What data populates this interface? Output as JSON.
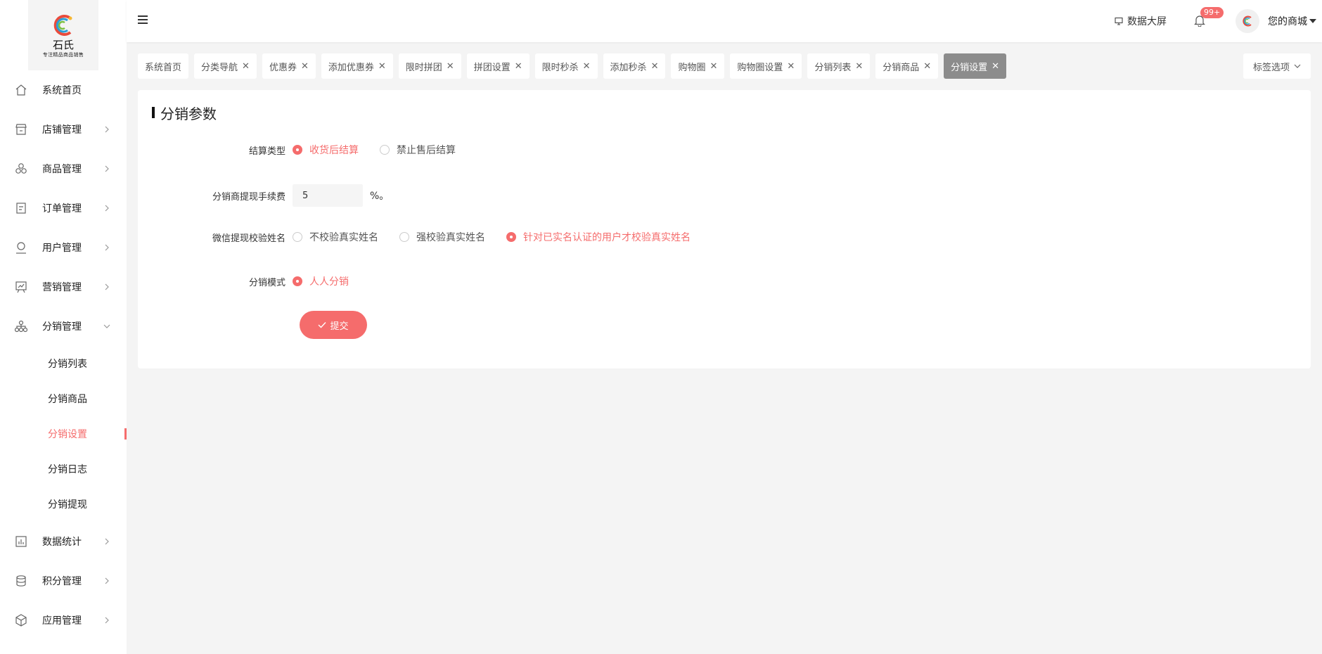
{
  "brand": {
    "name": "石氏",
    "slogan": "专注精品商品销售"
  },
  "sidebar": {
    "items": [
      {
        "label": "系统首页",
        "icon": "home-icon"
      },
      {
        "label": "店铺管理",
        "icon": "store-icon"
      },
      {
        "label": "商品管理",
        "icon": "goods-icon"
      },
      {
        "label": "订单管理",
        "icon": "order-icon"
      },
      {
        "label": "用户管理",
        "icon": "user-icon"
      },
      {
        "label": "营销管理",
        "icon": "marketing-icon"
      },
      {
        "label": "分销管理",
        "icon": "distribution-icon"
      },
      {
        "label": "数据统计",
        "icon": "chart-icon"
      },
      {
        "label": "积分管理",
        "icon": "points-icon"
      },
      {
        "label": "应用管理",
        "icon": "app-icon"
      }
    ],
    "sub_items": [
      "分销列表",
      "分销商品",
      "分销设置",
      "分销日志",
      "分销提现"
    ],
    "active_sub": "分销设置"
  },
  "header": {
    "screen_label": "数据大屏",
    "notification_badge": "99+",
    "shop_name": "您的商城"
  },
  "tabs": [
    {
      "label": "系统首页",
      "closable": false
    },
    {
      "label": "分类导航",
      "closable": true
    },
    {
      "label": "优惠券",
      "closable": true
    },
    {
      "label": "添加优惠券",
      "closable": true
    },
    {
      "label": "限时拼团",
      "closable": true
    },
    {
      "label": "拼团设置",
      "closable": true
    },
    {
      "label": "限时秒杀",
      "closable": true
    },
    {
      "label": "添加秒杀",
      "closable": true
    },
    {
      "label": "购物圈",
      "closable": true
    },
    {
      "label": "购物圈设置",
      "closable": true
    },
    {
      "label": "分销列表",
      "closable": true
    },
    {
      "label": "分销商品",
      "closable": true
    },
    {
      "label": "分销设置",
      "closable": true,
      "active": true
    }
  ],
  "tab_options_label": "标签选项",
  "form": {
    "title": "分销参数",
    "settlement": {
      "label": "结算类型",
      "options": [
        "收货后结算",
        "禁止售后结算"
      ],
      "selected": 0
    },
    "fee": {
      "label": "分销商提现手续费",
      "value": "5",
      "unit": "%。"
    },
    "name_check": {
      "label": "微信提现校验姓名",
      "options": [
        "不校验真实姓名",
        "强校验真实姓名",
        "针对已实名认证的用户才校验真实姓名"
      ],
      "selected": 2
    },
    "mode": {
      "label": "分销模式",
      "options": [
        "人人分销"
      ],
      "selected": 0
    },
    "submit_label": "提交"
  },
  "colors": {
    "accent": "#f56c6c",
    "active_tab": "#8c8c8c"
  }
}
